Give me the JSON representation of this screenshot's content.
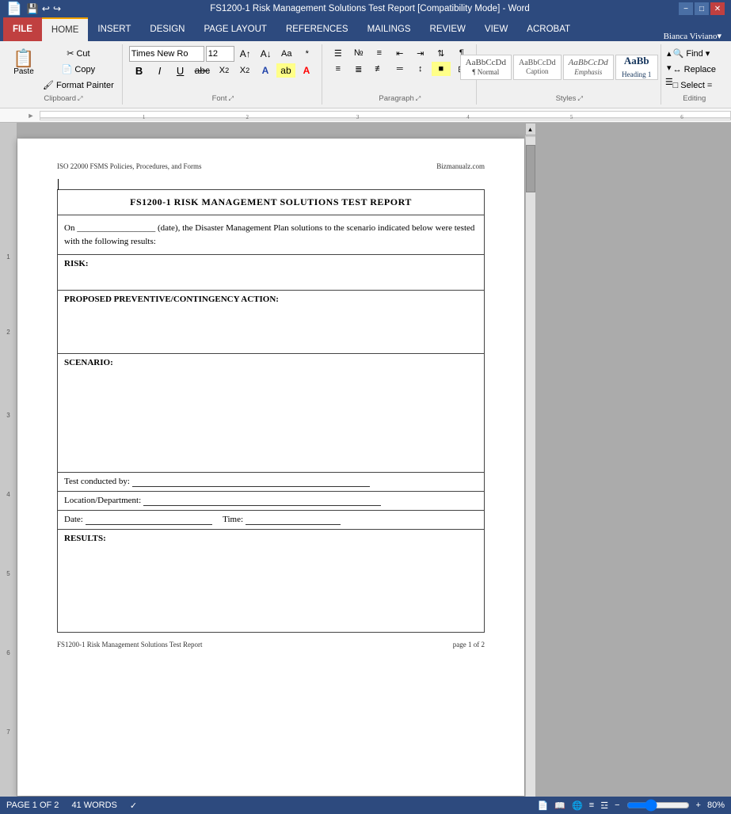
{
  "titlebar": {
    "title": "FS1200-1 Risk Management Solutions Test Report [Compatibility Mode] - Word",
    "controls": [
      "minimize",
      "maximize",
      "close"
    ]
  },
  "ribbon": {
    "tabs": [
      "FILE",
      "HOME",
      "INSERT",
      "DESIGN",
      "PAGE LAYOUT",
      "REFERENCES",
      "MAILINGS",
      "REVIEW",
      "VIEW",
      "ACROBAT"
    ],
    "active_tab": "HOME",
    "user": "Bianca Viviano",
    "font_name": "Times New Ro",
    "font_size": "12",
    "clipboard_label": "Clipboard",
    "font_label": "Font",
    "paragraph_label": "Paragraph",
    "styles_label": "Styles",
    "editing_label": "Editing",
    "styles": [
      "Caption",
      "Emphasis",
      "Heading 1"
    ],
    "styles_preview": [
      "AaBbCcDd",
      "AaBbCcDd",
      "AaBb"
    ],
    "find_label": "Find",
    "replace_label": "Replace",
    "select_label": "Select"
  },
  "document": {
    "header_left": "ISO 22000 FSMS Policies, Procedures, and Forms",
    "header_right": "Bizmanualz.com",
    "title": "FS1200-1 RISK MANAGEMENT SOLUTIONS TEST REPORT",
    "intro": "On __________________ (date), the Disaster Management Plan solutions to the scenario indicated below were tested with the following results:",
    "risk_label": "RISK:",
    "proposed_label": "PROPOSED PREVENTIVE/CONTINGENCY ACTION:",
    "scenario_label": "SCENARIO:",
    "test_conducted_label": "Test conducted by: ",
    "location_label": "Location/Department:",
    "date_label": "Date:",
    "time_label": "Time:",
    "results_label": "RESULTS:",
    "footer_left": "FS1200-1 Risk Management Solutions Test Report",
    "footer_right": "page 1 of 2"
  },
  "statusbar": {
    "page": "PAGE 1 OF 2",
    "words": "41 WORDS",
    "zoom": "80%"
  }
}
